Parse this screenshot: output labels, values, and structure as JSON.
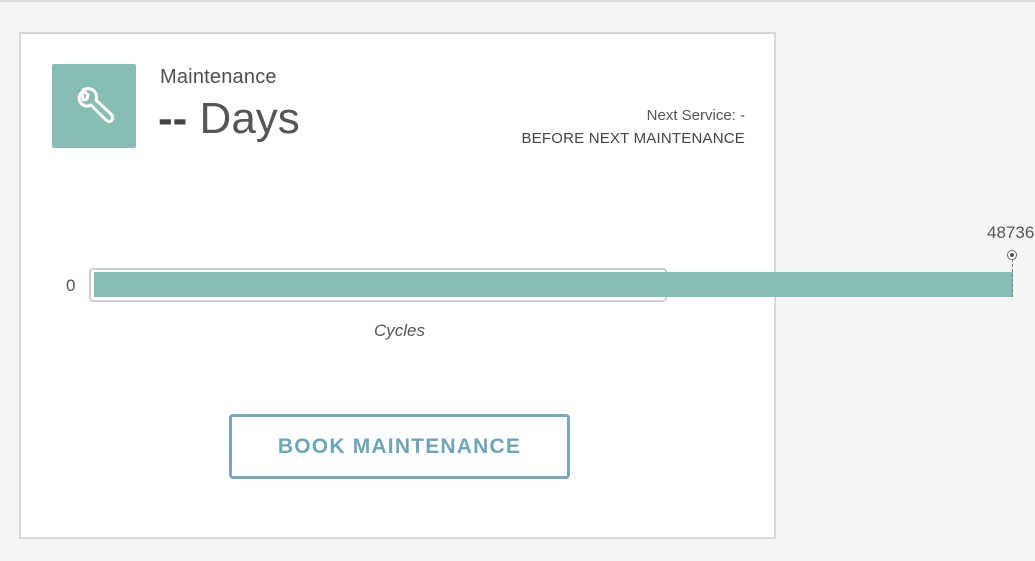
{
  "maintenance_card": {
    "title": "Maintenance",
    "days_value": "--",
    "days_unit": " Days",
    "next_service": "Next Service: -",
    "before_next": "BEFORE NEXT MAINTENANCE",
    "icon": "wrench-icon",
    "accent_color": "#88bdb4",
    "progress": {
      "min_label": "0",
      "marker_label": "48736",
      "axis_label": "Cycles",
      "fill_fraction_of_track": 1.59
    },
    "book_button_label": "BOOK MAINTENANCE",
    "button_color": "#6ea6b8"
  }
}
